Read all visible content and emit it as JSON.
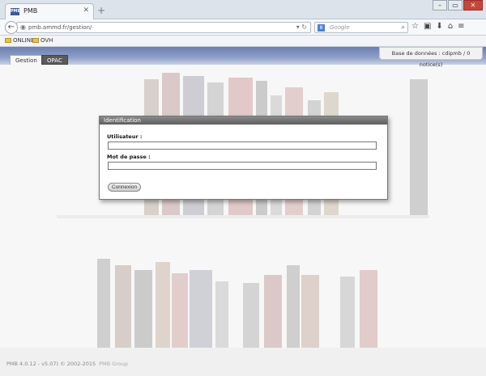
{
  "browser": {
    "tab_title": "PMB",
    "favicon": "pmb",
    "new_tab": "+",
    "url": "pmb.ammd.fr/gestion/",
    "search_placeholder": "Google",
    "search_engine": "8",
    "window_buttons": [
      "–",
      "▭",
      "✕"
    ],
    "bookmarks": [
      "ONLINE",
      "OVH"
    ]
  },
  "app": {
    "tabs": [
      {
        "label": "Gestion",
        "active": true
      },
      {
        "label": "OPAC",
        "active": false
      }
    ],
    "db_info": "Base de données : cdipmb / 0 notice(s)"
  },
  "login": {
    "title": "Identification",
    "user_label": "Utilisateur :",
    "user_value": "",
    "password_label": "Mot de passe :",
    "password_value": "",
    "submit_label": "Connexion"
  },
  "footer": {
    "version": "PMB 4.0.12 - v5.07) © 2002-2015",
    "vendor": "PMB Group"
  },
  "colors": {
    "band": "#6d7fb0",
    "dialog_header": "#6b6b6b"
  }
}
